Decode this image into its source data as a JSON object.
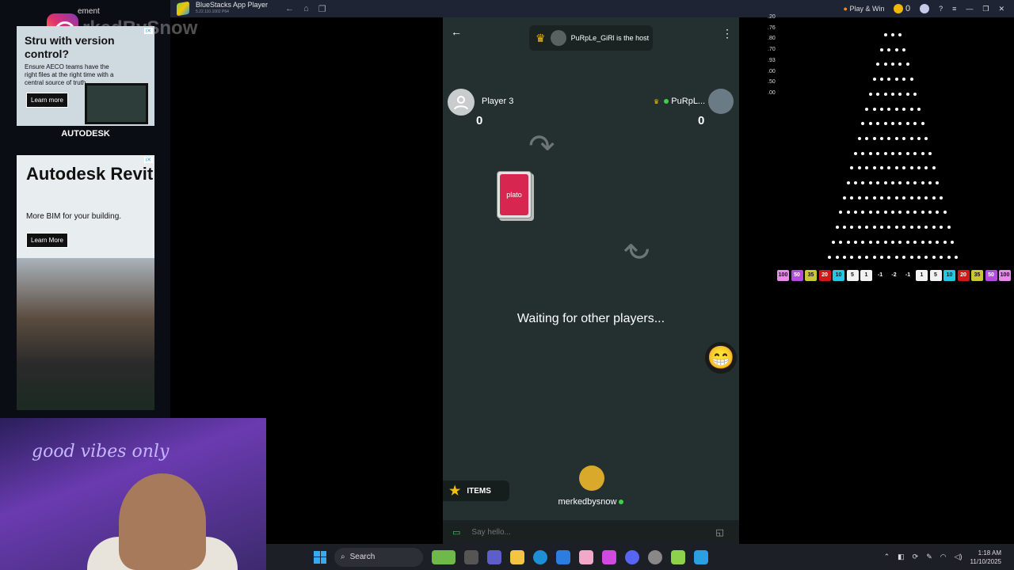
{
  "window": {
    "title": "BlueStacks App Player",
    "subtitle": "5.22.110.1002 P64",
    "play_win": "Play & Win",
    "coins": "0"
  },
  "ads": {
    "label": "ement",
    "watermark": "rkedBySnow",
    "ad1": {
      "headline": "Stru with version control?",
      "body": "Ensure AECO teams have the right files at the right time with a central source of truth",
      "button": "Learn more",
      "brand": "AUTODESK"
    },
    "ad2": {
      "headline": "Autodesk Revit",
      "body": "More BIM for your building.",
      "button": "Learn More"
    }
  },
  "game": {
    "host_text": "PuRpLe_GiRl is the host",
    "player_left": {
      "name": "Player 3",
      "score": "0"
    },
    "player_right": {
      "name": "PuRpL...",
      "score": "0"
    },
    "card_brand": "plato",
    "status": "Waiting for other players...",
    "items_label": "ITEMS",
    "me_name": "merkedbysnow",
    "chat_placeholder": "Say hello..."
  },
  "plinko": {
    "multipliers": [
      ".20",
      ".76",
      ".80",
      ".70",
      ".93",
      ".00",
      ".50",
      ".00"
    ],
    "slots": [
      {
        "v": "100",
        "c": "#e58de8"
      },
      {
        "v": "50",
        "c": "#b44be0"
      },
      {
        "v": "35",
        "c": "#c8c830"
      },
      {
        "v": "20",
        "c": "#d01818"
      },
      {
        "v": "10",
        "c": "#26c8e0"
      },
      {
        "v": "5",
        "c": "#f2f2f2"
      },
      {
        "v": "1",
        "c": "#f2f2f2"
      },
      {
        "v": "-1",
        "c": "#000000"
      },
      {
        "v": "-2",
        "c": "#000000"
      },
      {
        "v": "-1",
        "c": "#000000"
      },
      {
        "v": "1",
        "c": "#f2f2f2"
      },
      {
        "v": "5",
        "c": "#f2f2f2"
      },
      {
        "v": "10",
        "c": "#26c8e0"
      },
      {
        "v": "20",
        "c": "#d01818"
      },
      {
        "v": "35",
        "c": "#c8c830"
      },
      {
        "v": "50",
        "c": "#b44be0"
      },
      {
        "v": "100",
        "c": "#e58de8"
      }
    ]
  },
  "webcam": {
    "neon_text": "good vibes only"
  },
  "taskbar": {
    "search_label": "Search",
    "time": "1:18 AM",
    "date": "11/10/2025"
  }
}
